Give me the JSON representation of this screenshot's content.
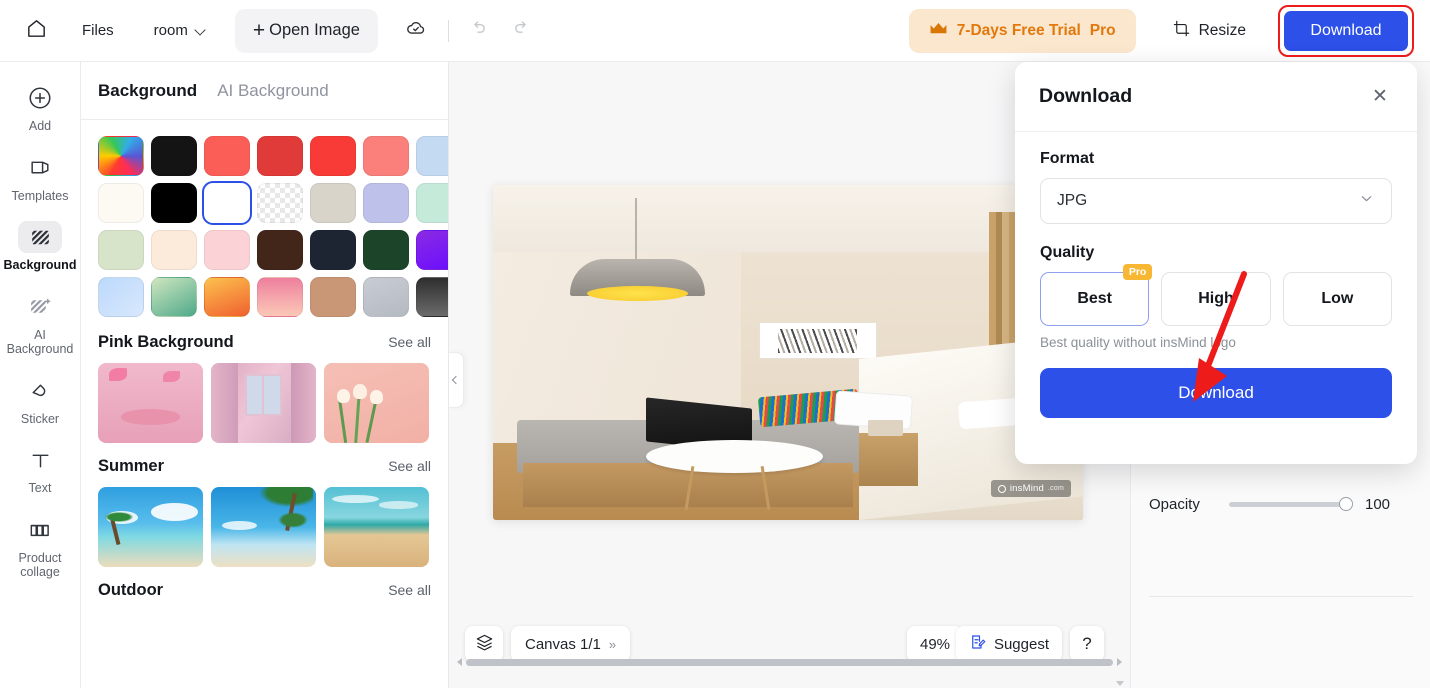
{
  "topbar": {
    "home_icon": "home-icon",
    "files_label": "Files",
    "doc_name": "room",
    "doc_caret_icon": "chevron-down-icon",
    "open_image_label": "Open Image",
    "plus_glyph": "+",
    "cloud_icon": "cloud-saved-icon",
    "undo_icon": "undo-icon",
    "redo_icon": "redo-icon",
    "trial_label": "7-Days Free Trial",
    "trial_pro": "Pro",
    "crown_icon": "crown-icon",
    "resize_label": "Resize",
    "resize_icon": "resize-icon",
    "download_label": "Download",
    "download_highlight_color": "#ee1b1b",
    "accent_blue": "#2c50e8",
    "trial_bg": "#fbe6ce",
    "trial_fg": "#e2790c"
  },
  "rail": {
    "items": [
      {
        "label": "Add",
        "icon": "plus-circle-icon",
        "active": false
      },
      {
        "label": "Templates",
        "icon": "templates-icon",
        "active": false
      },
      {
        "label": "Background",
        "icon": "background-hatch-icon",
        "active": true
      },
      {
        "label": "AI Background",
        "icon": "ai-background-icon",
        "active": false
      },
      {
        "label": "Sticker",
        "icon": "sticker-icon",
        "active": false
      },
      {
        "label": "Text",
        "icon": "text-icon",
        "active": false
      },
      {
        "label": "Product collage",
        "icon": "product-collage-icon",
        "active": false
      }
    ]
  },
  "panel": {
    "tabs": [
      {
        "label": "Background",
        "active": true
      },
      {
        "label": "AI Background",
        "active": false
      }
    ],
    "swatches": [
      {
        "name": "rainbow-picker",
        "css": "conic-gradient(from 210deg,#ff3b30,#ffcc00,#34c759,#32ade6,#5856d6,#ff2d55,#ff3b30)",
        "selected": false
      },
      {
        "name": "near-black",
        "css": "#141414",
        "selected": false
      },
      {
        "name": "coral-red",
        "css": "#fa5e57",
        "selected": false
      },
      {
        "name": "brick-red",
        "css": "#e03b39",
        "selected": false
      },
      {
        "name": "pure-red",
        "css": "#f93b37",
        "selected": false
      },
      {
        "name": "salmon",
        "css": "#fb7f7b",
        "selected": false
      },
      {
        "name": "powder-blue",
        "css": "#c4d9f2",
        "selected": false
      },
      {
        "name": "ivory",
        "css": "#fdfaf3",
        "selected": false
      },
      {
        "name": "black",
        "css": "#000000",
        "selected": false
      },
      {
        "name": "white",
        "css": "#ffffff",
        "selected": true
      },
      {
        "name": "transparent",
        "css": "repeating-conic-gradient(#e8e8e8 0% 25%, #ffffff 0% 50%) 50%/10px 10px",
        "selected": false
      },
      {
        "name": "warm-grey",
        "css": "#d8d4ca",
        "selected": false
      },
      {
        "name": "periwinkle",
        "css": "#bec2ea",
        "selected": false
      },
      {
        "name": "mint",
        "css": "#c6ead9",
        "selected": false
      },
      {
        "name": "sage",
        "css": "#d8e4c9",
        "selected": false
      },
      {
        "name": "peach-cream",
        "css": "#fceadb",
        "selected": false
      },
      {
        "name": "blush-pink",
        "css": "#fbd3d6",
        "selected": false
      },
      {
        "name": "dark-brown",
        "css": "#43261a",
        "selected": false
      },
      {
        "name": "navy-charcoal",
        "css": "#1d2533",
        "selected": false
      },
      {
        "name": "forest-green",
        "css": "#1c4428",
        "selected": false
      },
      {
        "name": "violet",
        "css": "linear-gradient(160deg,#8a2be2,#6a0dff)",
        "selected": false
      },
      {
        "name": "sky-gradient",
        "css": "linear-gradient(140deg,#bcd9fb,#d8e8fd)",
        "selected": false
      },
      {
        "name": "green-gradient",
        "css": "linear-gradient(150deg,#cfe6bf,#4fa98a)",
        "selected": false
      },
      {
        "name": "orange-gradient",
        "css": "linear-gradient(160deg,#fcc14f,#f0602e)",
        "selected": false
      },
      {
        "name": "pink-gradient",
        "css": "linear-gradient(180deg,#ee7f9e,#fbc9b6)",
        "selected": false
      },
      {
        "name": "tan",
        "css": "#c99775",
        "selected": false
      },
      {
        "name": "silver",
        "css": "linear-gradient(160deg,#c8ccd3,#b5bac2)",
        "selected": false
      },
      {
        "name": "graphite",
        "css": "linear-gradient(180deg,#2e2e2e,#6b6b6b)",
        "selected": false
      }
    ],
    "sections": [
      {
        "title": "Pink Background",
        "see_all": "See all",
        "thumbs": [
          "pink-podium",
          "pink-curtain-window",
          "pink-tulips"
        ]
      },
      {
        "title": "Summer",
        "see_all": "See all",
        "thumbs": [
          "beach-palm",
          "palm-shore",
          "sand-sea"
        ]
      },
      {
        "title": "Outdoor",
        "see_all": "See all",
        "thumbs": []
      }
    ],
    "collapse_icon": "chevron-left-icon"
  },
  "canvas": {
    "watermark": "insMind",
    "watermark_tld": ".com",
    "layers_icon": "layers-icon",
    "canvas_label": "Canvas 1/1",
    "canvas_expand_icon": "double-chevron-right-icon",
    "zoom_level": "49%",
    "suggest_label": "Suggest",
    "suggest_icon": "suggest-note-icon",
    "help_label": "?"
  },
  "right_panel": {
    "opacity_label": "Opacity",
    "opacity_value": "100"
  },
  "dialog": {
    "title": "Download",
    "close_icon": "close-icon",
    "format_label": "Format",
    "format_value": "JPG",
    "format_caret_icon": "chevron-down-icon",
    "quality_label": "Quality",
    "quality_options": [
      {
        "label": "Best",
        "badge": "Pro",
        "selected": true
      },
      {
        "label": "High",
        "badge": "",
        "selected": false
      },
      {
        "label": "Low",
        "badge": "",
        "selected": false
      }
    ],
    "quality_hint": "Best quality without insMind logo",
    "download_label": "Download",
    "annotation_arrow_color": "#ee1b1b"
  }
}
